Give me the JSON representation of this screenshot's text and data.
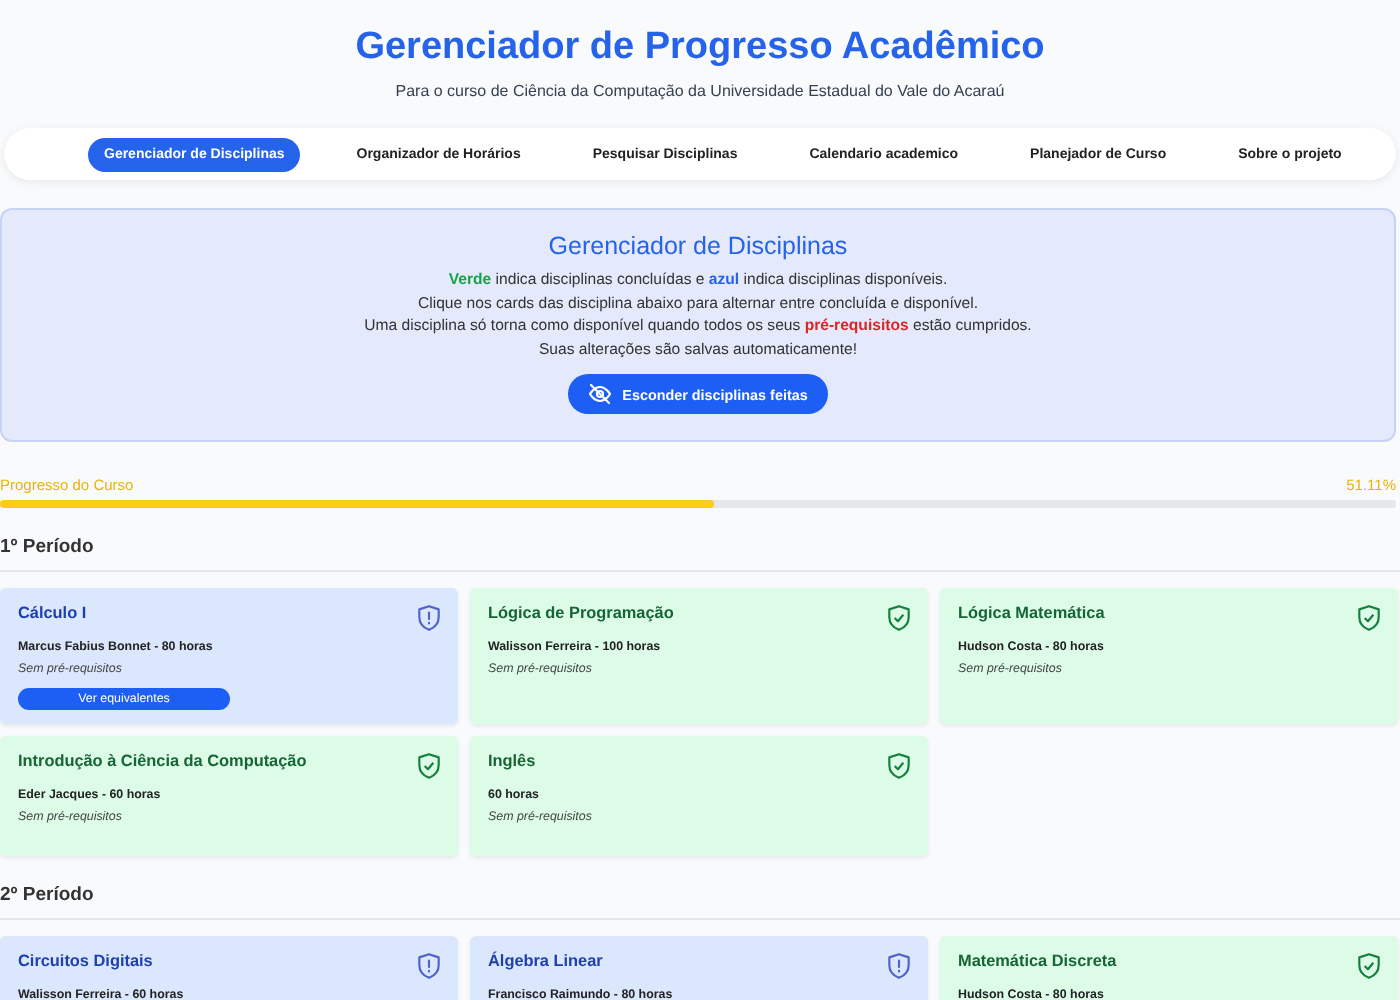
{
  "header": {
    "title": "Gerenciador de Progresso Acadêmico",
    "subtitle": "Para o curso de Ciência da Computação da Universidade Estadual do Vale do Acaraú"
  },
  "nav": [
    {
      "label": "Gerenciador de Disciplinas",
      "selected": true
    },
    {
      "label": "Organizador de Horários",
      "selected": false
    },
    {
      "label": "Pesquisar Disciplinas",
      "selected": false
    },
    {
      "label": "Calendario academico",
      "selected": false
    },
    {
      "label": "Planejador de Curso",
      "selected": false
    },
    {
      "label": "Sobre o projeto",
      "selected": false
    }
  ],
  "info": {
    "title": "Gerenciador de Disciplinas",
    "lines": [
      [
        {
          "text": "Verde",
          "color": "#16a34a"
        },
        {
          "text": " indica disciplinas concluídas e "
        },
        {
          "text": "azul",
          "color": "#2563eb"
        },
        {
          "text": " indica disciplinas disponíveis."
        }
      ],
      [
        {
          "text": "Clique nos cards das disciplina abaixo para alternar entre concluída e disponível."
        }
      ],
      [
        {
          "text": "Uma disciplina só torna como disponível quando todos os seus "
        },
        {
          "text": "pré-requisitos",
          "color": "#dc2626"
        },
        {
          "text": " estão cumpridos."
        }
      ],
      [
        {
          "text": "Suas alterações são salvas automaticamente!"
        }
      ]
    ],
    "button": "Esconder disciplinas feitas"
  },
  "progress": {
    "label": "Progresso do Curso",
    "reading": "51.11%",
    "level": 0.5111
  },
  "periods": [
    {
      "title": "1º Período",
      "courses": [
        {
          "name": "Cálculo I",
          "details": "Marcus Fabius Bonnet - 80 horas",
          "prereq": "Sem pré-requisitos",
          "kind": "available",
          "button": "Ver equivalentes"
        },
        {
          "name": "Lógica de Programação",
          "details": "Walisson Ferreira - 100 horas",
          "prereq": "Sem pré-requisitos",
          "kind": "done"
        },
        {
          "name": "Lógica Matemática",
          "details": "Hudson Costa - 80 horas",
          "prereq": "Sem pré-requisitos",
          "kind": "done"
        },
        {
          "name": "Introdução à Ciência da Computação",
          "details": "Eder Jacques - 60 horas",
          "prereq": "Sem pré-requisitos",
          "kind": "done"
        },
        {
          "name": "Inglês",
          "details": "60 horas",
          "prereq": "Sem pré-requisitos",
          "kind": "done"
        }
      ]
    },
    {
      "title": "2º Período",
      "courses": [
        {
          "name": "Circuitos Digitais",
          "details": "Walisson Ferreira - 60 horas",
          "kind": "available"
        },
        {
          "name": "Álgebra Linear",
          "details": "Francisco Raimundo - 80 horas",
          "kind": "available"
        },
        {
          "name": "Matemática Discreta",
          "details": "Hudson Costa - 80 horas",
          "kind": "done"
        }
      ]
    }
  ]
}
